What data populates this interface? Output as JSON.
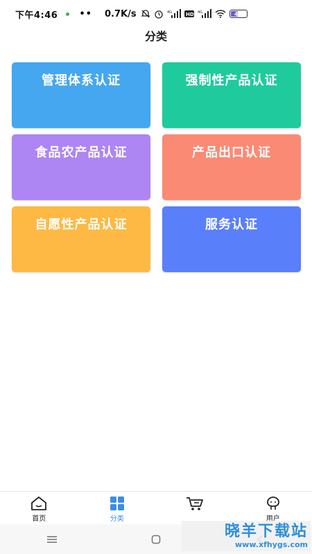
{
  "status_bar": {
    "time": "下午4:46",
    "dots": "••",
    "speed": "0.7K/s",
    "battery": "47"
  },
  "page_title": "分类",
  "categories": [
    {
      "label": "管理体系认证",
      "color": "#45a7f0"
    },
    {
      "label": "强制性产品认证",
      "color": "#1fcb9c"
    },
    {
      "label": "食品农产品认证",
      "color": "#ad86f4"
    },
    {
      "label": "产品出口认证",
      "color": "#fb8a75"
    },
    {
      "label": "自愿性产品认证",
      "color": "#fdb944"
    },
    {
      "label": "服务认证",
      "color": "#5a7ffa"
    }
  ],
  "tabs": [
    {
      "label": "首页",
      "icon": "home-icon",
      "active": false
    },
    {
      "label": "分类",
      "icon": "grid-icon",
      "active": true
    },
    {
      "label": "",
      "icon": "cart-icon",
      "active": false
    },
    {
      "label": "用户",
      "icon": "user-icon",
      "active": false
    }
  ],
  "colors": {
    "accent": "#3a8ee6"
  },
  "watermark": {
    "title": "晓羊下载站",
    "url": "www.xfhygs.com"
  }
}
